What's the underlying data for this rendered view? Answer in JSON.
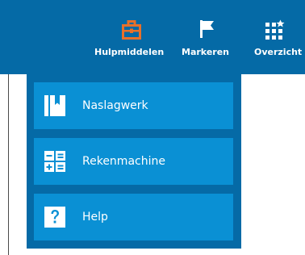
{
  "colors": {
    "topbar": "#056aa6",
    "menu_panel": "#056aa6",
    "menu_item": "#0a90d4",
    "active_icon": "#e8702a",
    "text": "#ffffff"
  },
  "nav": {
    "items": [
      {
        "label": "Hulpmiddelen",
        "icon": "briefcase-icon",
        "active": true
      },
      {
        "label": "Markeren",
        "icon": "flag-icon",
        "active": false
      },
      {
        "label": "Overzicht",
        "icon": "grid-star-icon",
        "active": false
      }
    ]
  },
  "dropdown": {
    "items": [
      {
        "label": "Naslagwerk",
        "icon": "book-icon"
      },
      {
        "label": "Rekenmachine",
        "icon": "calculator-icon"
      },
      {
        "label": "Help",
        "icon": "help-question-icon"
      }
    ]
  }
}
